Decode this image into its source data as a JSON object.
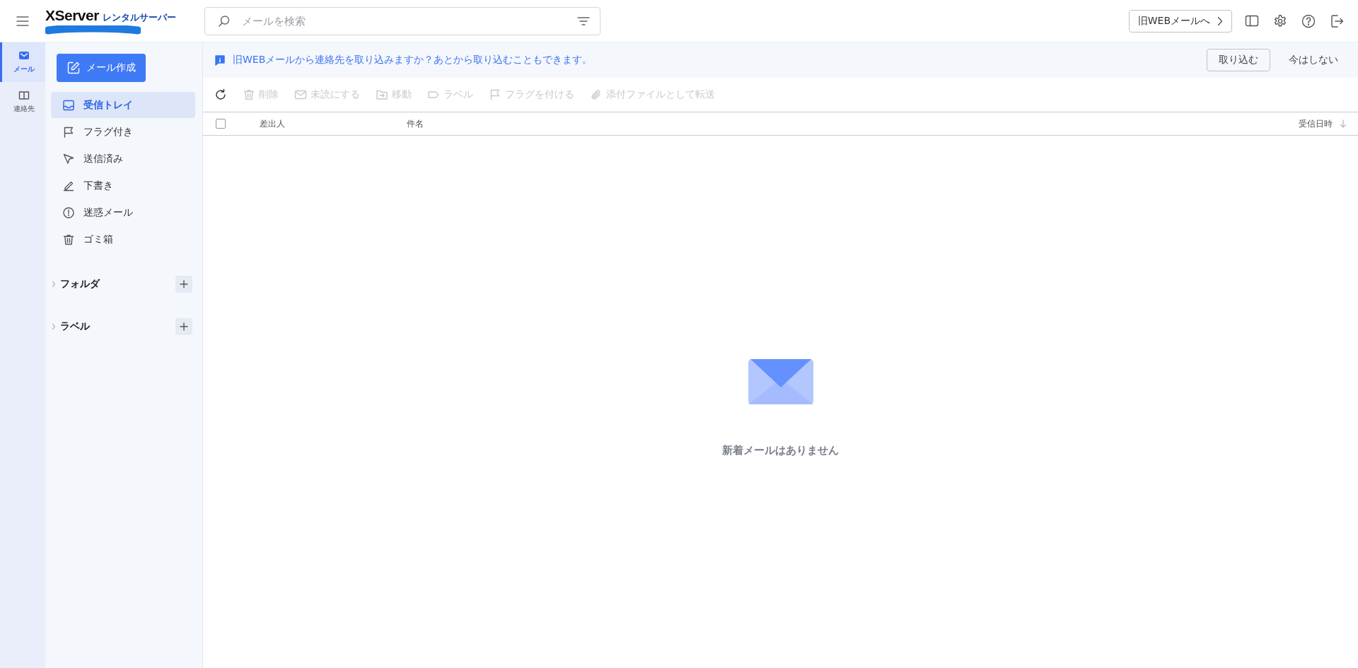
{
  "header": {
    "logo": "XServer",
    "logo_sub": "レンタルサーバー",
    "search": {
      "placeholder": "メールを検索"
    },
    "old_webmail_button": "旧WEBメールへ"
  },
  "rail": [
    {
      "label": "メール",
      "selected": true
    },
    {
      "label": "連絡先",
      "selected": false
    }
  ],
  "compose_button": "メール作成",
  "folders": [
    {
      "label": "受信トレイ",
      "selected": true
    },
    {
      "label": "フラグ付き",
      "selected": false
    },
    {
      "label": "送信済み",
      "selected": false
    },
    {
      "label": "下書き",
      "selected": false
    },
    {
      "label": "迷惑メール",
      "selected": false
    },
    {
      "label": "ゴミ箱",
      "selected": false
    }
  ],
  "sections": [
    {
      "label": "フォルダ",
      "expanded": false
    },
    {
      "label": "ラベル",
      "expanded": false
    }
  ],
  "banner": {
    "message": "旧WEBメールから連絡先を取り込みますか？あとから取り込むこともできます。",
    "import_button": "取り込む",
    "dismiss_button": "今はしない"
  },
  "toolbar": [
    {
      "disabled": false
    },
    {
      "label": "削除",
      "disabled": true
    },
    {
      "label": "未読にする",
      "disabled": true
    },
    {
      "label": "移動",
      "disabled": true
    },
    {
      "label": "ラベル",
      "disabled": true
    },
    {
      "label": "フラグを付ける",
      "disabled": true
    },
    {
      "label": "添付ファイルとして転送",
      "disabled": true
    }
  ],
  "table": {
    "select_all_checked": false,
    "columns": [
      "差出人",
      "件名",
      "受信日時"
    ]
  },
  "empty_state": "新着メールはありません"
}
